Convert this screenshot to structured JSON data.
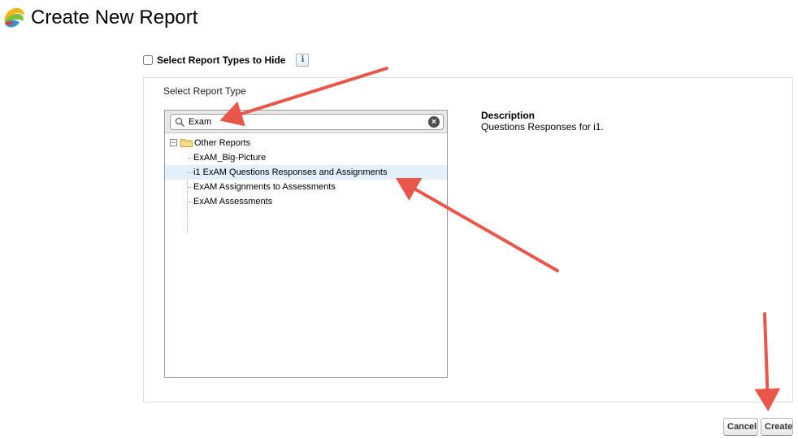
{
  "page": {
    "title": "Create New Report"
  },
  "hide_types": {
    "label": "Select Report Types to Hide",
    "checked": false,
    "info_icon": "i"
  },
  "selector": {
    "label": "Select Report Type",
    "search": {
      "value": "Exam",
      "icon": "search-icon",
      "clear_icon": "×"
    },
    "tree": {
      "folder": {
        "label": "Other Reports",
        "expanded": true,
        "toggle_symbol": "−"
      },
      "items": [
        {
          "label": "ExAM_Big-Picture",
          "selected": false
        },
        {
          "label": "i1 ExAM Questions Responses and Assignments",
          "selected": true
        },
        {
          "label": "ExAM Assignments to Assessments",
          "selected": false
        },
        {
          "label": "ExAM Assessments",
          "selected": false
        }
      ]
    }
  },
  "description": {
    "title": "Description",
    "text": "Questions Responses for i1."
  },
  "buttons": {
    "cancel": "Cancel",
    "create": "Create"
  },
  "colors": {
    "annotation_arrow": "#e8574a",
    "selected_row": "#e3f0fa"
  }
}
